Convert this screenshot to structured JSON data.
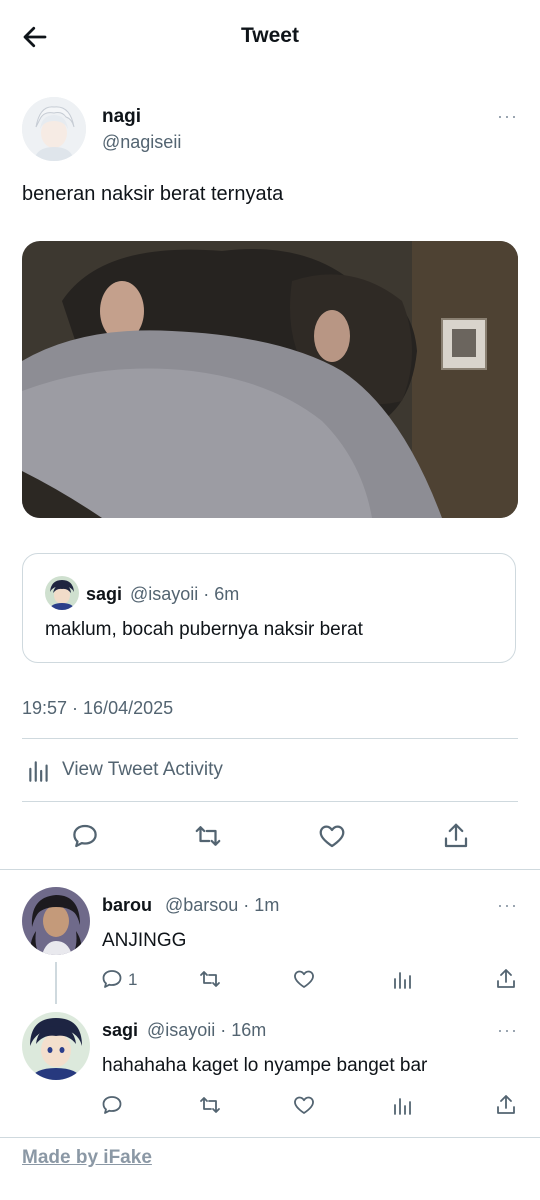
{
  "header": {
    "title": "Tweet",
    "back_icon": "arrow-left-icon"
  },
  "tweet": {
    "author_name": "nagi",
    "author_handle": "@nagiseii",
    "more": "···",
    "text": "beneran naksir berat ternyata",
    "quote": {
      "name": "sagi",
      "meta": "@isayoii · 6m",
      "text": "maklum, bocah pubernya naksir berat"
    },
    "timestamp": "19:57 · 16/04/2025",
    "activity_label": "View Tweet Activity"
  },
  "replies": [
    {
      "name": "barou",
      "meta": "@barsou · 1m",
      "text": "ANJINGG",
      "reply_count": "1",
      "more": "···"
    },
    {
      "name": "sagi",
      "meta": "@isayoii · 16m",
      "text": "hahahaha kaget lo nyampe banget bar",
      "more": "···"
    }
  ],
  "footer": {
    "watermark": "Made by iFake"
  },
  "colors": {
    "text": "#0f1419",
    "muted": "#536471",
    "divider": "#cfd9de",
    "link": "#536471"
  }
}
